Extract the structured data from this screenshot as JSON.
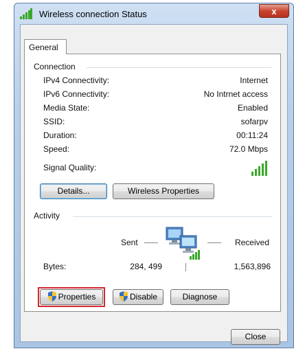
{
  "window": {
    "title": "Wireless connection Status",
    "close_glyph": "x"
  },
  "tabs": [
    {
      "label": "General"
    }
  ],
  "connection": {
    "section_label": "Connection",
    "rows": [
      {
        "label": "IPv4 Connectivity:",
        "value": "Internet"
      },
      {
        "label": "IPv6 Connectivity:",
        "value": "No Intrnet access"
      },
      {
        "label": "Media State:",
        "value": "Enabled"
      },
      {
        "label": "SSID:",
        "value": "sofarpv"
      },
      {
        "label": "Duration:",
        "value": "00:11:24"
      },
      {
        "label": "Speed:",
        "value": "72.0 Mbps"
      }
    ],
    "signal_label": "Signal Quality:",
    "signal_icon": "signal-bars-icon",
    "signal_level": "5/5",
    "details_button": "Details...",
    "wireless_properties_button": "Wireless Properties"
  },
  "activity": {
    "section_label": "Activity",
    "sent_label": "Sent",
    "received_label": "Received",
    "bytes_label": "Bytes:",
    "bytes_sent": "284, 499",
    "bytes_received": "1,563,896"
  },
  "buttons": {
    "properties": "Properties",
    "disable": "Disable",
    "diagnose": "Diagnose",
    "close": "Close"
  },
  "colors": {
    "highlight": "#d0262f",
    "signal": "#3aa82a",
    "close_red": "#c8442f"
  }
}
